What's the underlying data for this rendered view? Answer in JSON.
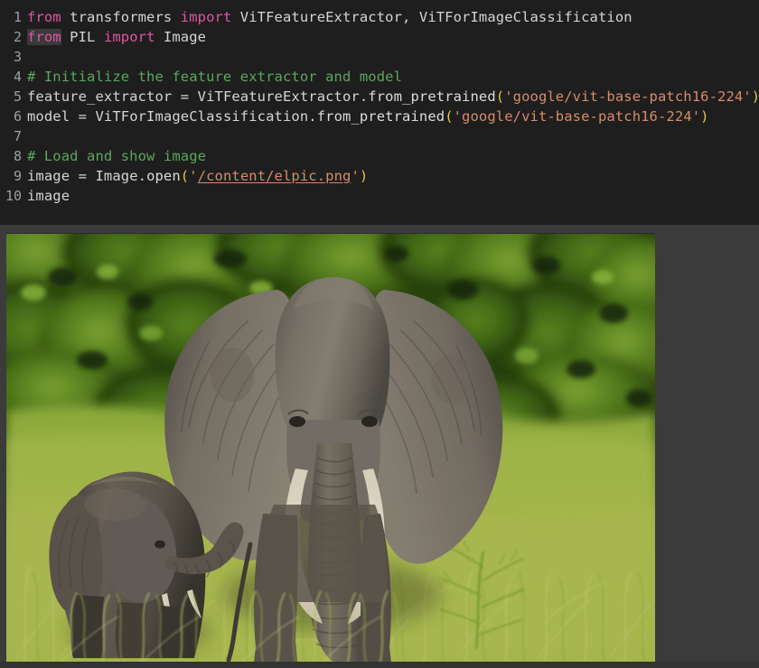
{
  "cell": {
    "background_color": "#1e1e1e",
    "line_numbers": [
      "1",
      "2",
      "3",
      "4",
      "5",
      "6",
      "7",
      "8",
      "9",
      "10"
    ],
    "lines": [
      {
        "n": "1",
        "text": "from transformers import ViTFeatureExtractor, ViTForImageClassification",
        "tokens": [
          {
            "t": "from",
            "c": "kw"
          },
          {
            "t": " transformers ",
            "c": "name"
          },
          {
            "t": "import",
            "c": "kw"
          },
          {
            "t": " ViTFeatureExtractor",
            "c": "cls"
          },
          {
            "t": ", ",
            "c": "punct"
          },
          {
            "t": "ViTForImageClassification",
            "c": "cls"
          }
        ]
      },
      {
        "n": "2",
        "text": "from PIL import Image",
        "tokens": [
          {
            "t": "from",
            "c": "kw-hl"
          },
          {
            "t": " PIL ",
            "c": "name"
          },
          {
            "t": "import",
            "c": "kw"
          },
          {
            "t": " Image",
            "c": "cls"
          }
        ]
      },
      {
        "n": "3",
        "text": "",
        "tokens": []
      },
      {
        "n": "4",
        "text": "# Initialize the feature extractor and model",
        "tokens": [
          {
            "t": "# Initialize the feature extractor and model",
            "c": "comment"
          }
        ]
      },
      {
        "n": "5",
        "text": "feature_extractor = ViTFeatureExtractor.from_pretrained('google/vit-base-patch16-224')",
        "tokens": [
          {
            "t": "feature_extractor ",
            "c": "name"
          },
          {
            "t": "=",
            "c": "op"
          },
          {
            "t": " ViTFeatureExtractor",
            "c": "cls"
          },
          {
            "t": ".",
            "c": "punct"
          },
          {
            "t": "from_pretrained",
            "c": "fn"
          },
          {
            "t": "(",
            "c": "paren"
          },
          {
            "t": "'google/vit-base-patch16-224'",
            "c": "str"
          },
          {
            "t": ")",
            "c": "paren"
          }
        ]
      },
      {
        "n": "6",
        "text": "model = ViTForImageClassification.from_pretrained('google/vit-base-patch16-224')",
        "tokens": [
          {
            "t": "model ",
            "c": "name"
          },
          {
            "t": "=",
            "c": "op"
          },
          {
            "t": " ViTForImageClassification",
            "c": "cls"
          },
          {
            "t": ".",
            "c": "punct"
          },
          {
            "t": "from_pretrained",
            "c": "fn"
          },
          {
            "t": "(",
            "c": "paren"
          },
          {
            "t": "'google/vit-base-patch16-224'",
            "c": "str"
          },
          {
            "t": ")",
            "c": "paren"
          }
        ]
      },
      {
        "n": "7",
        "text": "",
        "tokens": []
      },
      {
        "n": "8",
        "text": "# Load and show image",
        "tokens": [
          {
            "t": "# Load and show image",
            "c": "comment"
          }
        ]
      },
      {
        "n": "9",
        "text": "image = Image.open('/content/elpic.png')",
        "tokens": [
          {
            "t": "image ",
            "c": "name"
          },
          {
            "t": "=",
            "c": "op"
          },
          {
            "t": " Image",
            "c": "cls"
          },
          {
            "t": ".",
            "c": "punct"
          },
          {
            "t": "open",
            "c": "fn"
          },
          {
            "t": "(",
            "c": "paren"
          },
          {
            "t": "'",
            "c": "str"
          },
          {
            "t": "/content/elpic.png",
            "c": "str-u"
          },
          {
            "t": "'",
            "c": "str"
          },
          {
            "t": ")",
            "c": "paren"
          }
        ]
      },
      {
        "n": "10",
        "text": "image",
        "tokens": [
          {
            "t": "image",
            "c": "name"
          }
        ]
      }
    ]
  },
  "output": {
    "background_color": "#3b3b3b",
    "image": {
      "alt": "Two African elephants, an adult with large tusks and a calf, standing in tall green grass with dense dark-green foliage behind them",
      "subjects": [
        "adult-elephant",
        "elephant-calf"
      ],
      "palette": {
        "foliage_dark": "#1d3210",
        "foliage_mid": "#3f6a1c",
        "foliage_light": "#7fae37",
        "grass_light": "#b9c65c",
        "grass_mid": "#9fb848",
        "elephant_body": "#6f6a62",
        "elephant_shadow": "#3d3a36",
        "elephant_highlight": "#8c867c",
        "tusk": "#e8e2d2"
      }
    }
  }
}
